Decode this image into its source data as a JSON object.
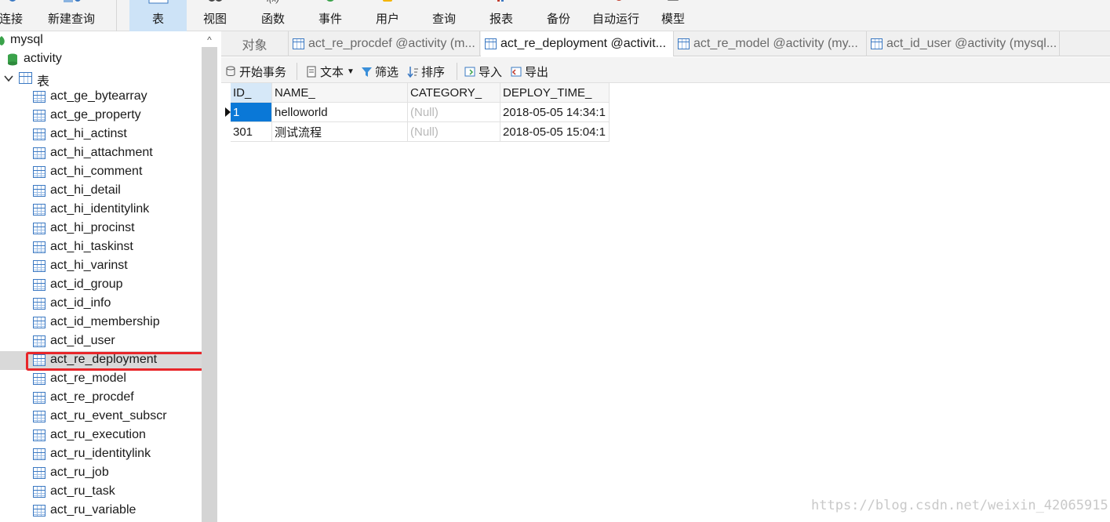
{
  "toolbar": {
    "items": [
      {
        "label": "连接",
        "icon": "connection-icon"
      },
      {
        "label": "新建查询",
        "icon": "new-query-icon"
      },
      {
        "label": "表",
        "icon": "table-icon",
        "active": true
      },
      {
        "label": "视图",
        "icon": "view-icon"
      },
      {
        "label": "函数",
        "icon": "function-icon"
      },
      {
        "label": "事件",
        "icon": "event-icon"
      },
      {
        "label": "用户",
        "icon": "user-icon"
      },
      {
        "label": "查询",
        "icon": "query-icon"
      },
      {
        "label": "报表",
        "icon": "report-icon"
      },
      {
        "label": "备份",
        "icon": "backup-icon"
      },
      {
        "label": "自动运行",
        "icon": "automation-icon"
      },
      {
        "label": "模型",
        "icon": "model-icon"
      }
    ]
  },
  "sidebar": {
    "connection": "mysql",
    "database": "activity",
    "folder": "表",
    "tables": [
      "act_ge_bytearray",
      "act_ge_property",
      "act_hi_actinst",
      "act_hi_attachment",
      "act_hi_comment",
      "act_hi_detail",
      "act_hi_identitylink",
      "act_hi_procinst",
      "act_hi_taskinst",
      "act_hi_varinst",
      "act_id_group",
      "act_id_info",
      "act_id_membership",
      "act_id_user",
      "act_re_deployment",
      "act_re_model",
      "act_re_procdef",
      "act_ru_event_subscr",
      "act_ru_execution",
      "act_ru_identitylink",
      "act_ru_job",
      "act_ru_task",
      "act_ru_variable"
    ],
    "selected_table": "act_re_deployment"
  },
  "tabs": [
    {
      "label": "对象"
    },
    {
      "label": "act_re_procdef @activity (m..."
    },
    {
      "label": "act_re_deployment @activit...",
      "active": true
    },
    {
      "label": "act_re_model @activity (my..."
    },
    {
      "label": "act_id_user @activity (mysql..."
    }
  ],
  "actions": {
    "begin_transaction": "开始事务",
    "text": "文本",
    "filter": "筛选",
    "sort": "排序",
    "import": "导入",
    "export": "导出"
  },
  "grid": {
    "columns": [
      "ID_",
      "NAME_",
      "CATEGORY_",
      "DEPLOY_TIME_"
    ],
    "rows": [
      [
        "1",
        "helloworld",
        "(Null)",
        "2018-05-05 14:34:1"
      ],
      [
        "301",
        "测试流程",
        "(Null)",
        "2018-05-05 15:04:1"
      ]
    ]
  },
  "watermark": "https://blog.csdn.net/weixin_42065915"
}
